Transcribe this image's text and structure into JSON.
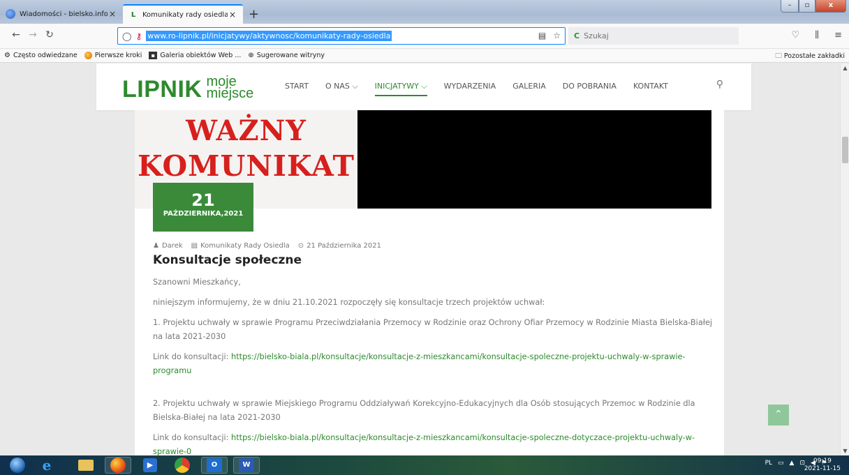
{
  "browser": {
    "tabs": [
      {
        "title": "Wiadomości - bielsko.info",
        "close": "×"
      },
      {
        "title": "Komunikaty rady osiedla",
        "favicon": "L",
        "close": "×"
      }
    ],
    "new_tab": "+",
    "url": "www.ro-lipnik.pl/inicjatywy/aktywnosc/komunikaty-rady-osiedla",
    "search_placeholder": "Szukaj",
    "bookmarks": [
      {
        "label": "Często odwiedzane",
        "icon": "gear-icon"
      },
      {
        "label": "Pierwsze kroki",
        "icon": "firefox-icon"
      },
      {
        "label": "Galeria obiektów Web ...",
        "icon": "gallery-icon"
      },
      {
        "label": "Sugerowane witryny",
        "icon": "globe-icon"
      }
    ],
    "other_bookmarks": "Pozostałe zakładki"
  },
  "site": {
    "logo": {
      "main": "LIPNIK",
      "line1": "moje",
      "line2": "miejsce",
      "color": "#2d8a2d"
    },
    "menu": [
      {
        "label": "START"
      },
      {
        "label": "O NAS ⌵"
      },
      {
        "label": "INICJATYWY ⌵",
        "active": true
      },
      {
        "label": "WYDARZENIA"
      },
      {
        "label": "GALERIA"
      },
      {
        "label": "DO POBRANIA"
      },
      {
        "label": "KONTAKT"
      }
    ]
  },
  "post": {
    "hero_line1": "WAŻNY",
    "hero_line2": "KOMUNIKAT",
    "date_day": "21",
    "date_month": "PAŹDZIERNIKA,2021",
    "author": "Darek",
    "category": "Komunikaty Rady Osiedla",
    "date": "21 Października 2021",
    "title": "Konsultacje społeczne",
    "greeting": "Szanowni Mieszkańcy,",
    "intro": "niniejszym informujemy, że w dniu 21.10.2021 rozpoczęły się konsultacje trzech projektów uchwał:",
    "item1": "1. Projektu uchwały w sprawie Programu Przeciwdziałania Przemocy w Rodzinie oraz Ochrony Ofiar Przemocy w Rodzinie Miasta Bielska-Białej na lata 2021-2030",
    "link_label": "Link do konsultacji:",
    "link1": "https://bielsko-biala.pl/konsultacje/konsultacje-z-mieszkancami/konsultacje-spoleczne-projektu-uchwaly-w-sprawie-programu",
    "item2": "2. Projektu uchwały w sprawie Miejskiego Programu Oddziaływań Korekcyjno-Edukacyjnych dla Osób stosujących Przemoc w Rodzinie dla Bielska-Białej na lata 2021-2030",
    "link2": "https://bielsko-biala.pl/konsultacje/konsultacje-z-mieszkancami/konsultacje-spoleczne-dotyczace-projektu-uchwaly-w-sprawie-0",
    "accent_color": "#3a8a3a",
    "hero_text_color": "#d7201d"
  },
  "taskbar": {
    "lang": "PL",
    "time": "09:19",
    "date": "2021-11-15"
  }
}
